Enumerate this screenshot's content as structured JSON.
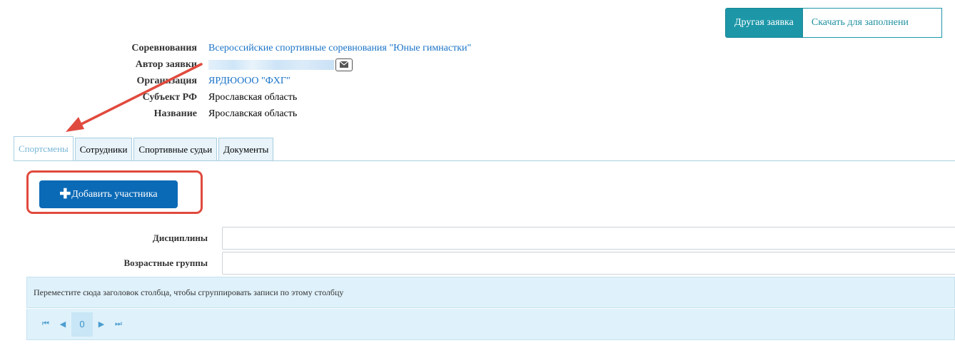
{
  "header": {
    "other_request_label": "Другая заявка",
    "download_label": "Скачать для заполнени"
  },
  "info": {
    "competition_label": "Соревнования",
    "competition_value": "Всероссийские спортивные соревнования \"Юные гимнастки\"",
    "author_label": "Автор заявки",
    "organization_label": "Организация",
    "organization_value": "ЯРДЮООО \"ФХГ\"",
    "subject_label": "Субъект РФ",
    "subject_value": "Ярославская область",
    "name_label": "Название",
    "name_value": "Ярославская область"
  },
  "tabs": [
    {
      "label": "Спортсмены",
      "active": true
    },
    {
      "label": "Сотрудники",
      "active": false
    },
    {
      "label": "Спортивные судьи",
      "active": false
    },
    {
      "label": "Документы",
      "active": false
    }
  ],
  "athletes": {
    "add_button_label": "Добавить участника",
    "disciplines_label": "Дисциплины",
    "disciplines_value": "",
    "age_groups_label": "Возрастные группы",
    "age_groups_value": "",
    "group_panel_text": "Переместите сюда заголовок столбца, чтобы сгруппировать записи по этому столбцу",
    "pager_page": "0"
  },
  "icons": {
    "mail": "envelope-icon",
    "add": "plus-icon",
    "first": "first-page-icon",
    "prev": "prev-page-icon",
    "next": "next-page-icon",
    "last": "last-page-icon"
  },
  "colors": {
    "accent_teal": "#1d97a8",
    "primary_blue": "#0b6ab6",
    "link_blue": "#1a73c7",
    "annotation_red": "#e04a3e",
    "grid_bg": "#dff1fa"
  }
}
